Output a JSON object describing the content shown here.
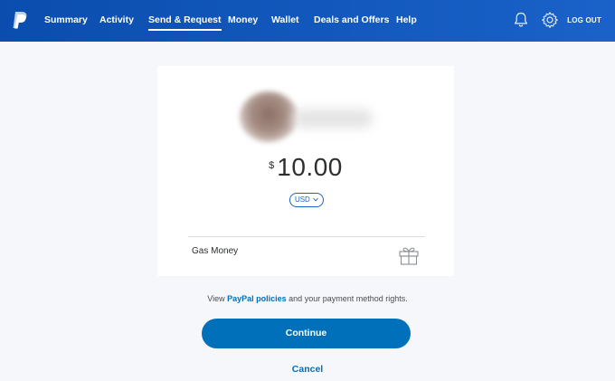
{
  "nav": {
    "items": [
      {
        "label": "Summary"
      },
      {
        "label": "Activity"
      },
      {
        "label": "Send & Request"
      },
      {
        "label": "Money"
      },
      {
        "label": "Wallet"
      },
      {
        "label": "Deals and Offers"
      },
      {
        "label": "Help"
      }
    ],
    "active": "Send & Request",
    "logout": "LOG OUT",
    "icons": [
      "paypal-logo-icon",
      "bell-icon",
      "gear-icon"
    ]
  },
  "payment": {
    "currency_symbol": "$",
    "amount": "10.00",
    "currency": "USD",
    "note": "Gas Money"
  },
  "policy": {
    "prefix": "View",
    "link": "PayPal policies",
    "suffix": "and your payment method rights."
  },
  "actions": {
    "continue": "Continue",
    "cancel": "Cancel"
  },
  "colors": {
    "nav_bg": "#0a4dae",
    "accent": "#0070ba",
    "page_bg": "#f5f7fa"
  }
}
